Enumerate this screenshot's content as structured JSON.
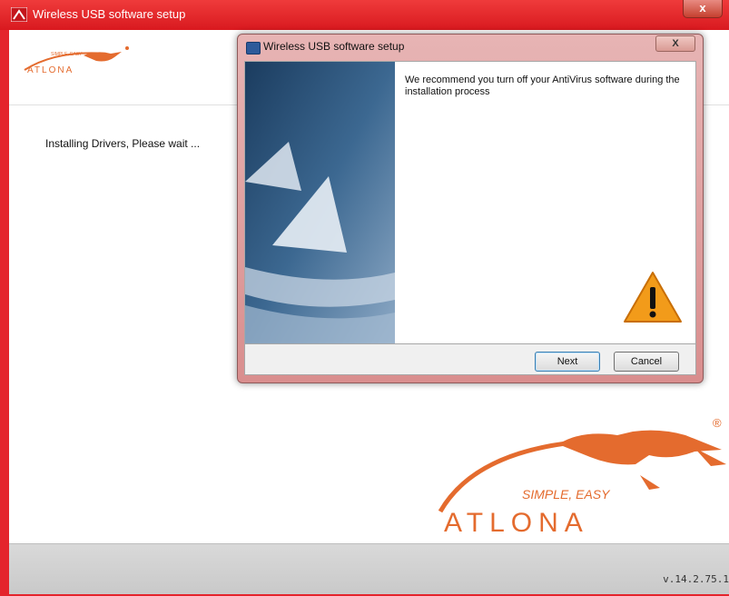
{
  "outer_window": {
    "title": "Wireless USB software setup",
    "close_glyph": "x",
    "title_icon": "atlona-triangle-icon"
  },
  "installer": {
    "status": "Installing Drivers, Please wait ...",
    "version": "v.14.2.75.1",
    "small_logo": {
      "tagline": "SIMPLE, EASY",
      "brand": "ATLONA"
    },
    "big_logo": {
      "tagline": "SIMPLE,  EASY",
      "brand": "ATLONA",
      "registered": "®"
    }
  },
  "dialog": {
    "title": "Wireless USB software setup",
    "close_glyph": "X",
    "title_icon": "setup-window-icon",
    "message": "We recommend you turn off your AntiVirus software during the installation process",
    "warning_icon": "warning-triangle-icon",
    "buttons": {
      "next": "Next",
      "cancel": "Cancel"
    }
  },
  "colors": {
    "frame_red": "#e4242c",
    "brand_orange": "#e46b2e",
    "banner_blue": "#1d3f63",
    "warning_orange": "#f29b1a"
  }
}
